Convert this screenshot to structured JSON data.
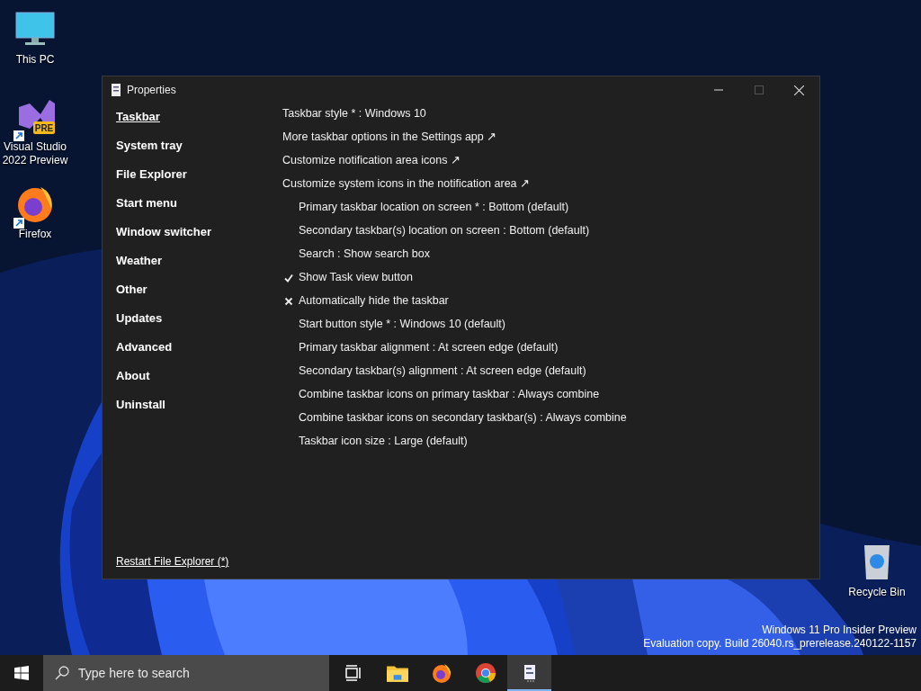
{
  "desktop_icons": [
    {
      "label": "This PC",
      "kind": "monitor",
      "shortcut": false
    },
    {
      "label": "Visual Studio\n2022 Preview",
      "kind": "vs",
      "shortcut": true,
      "badge": "PRE"
    },
    {
      "label": "Firefox",
      "kind": "firefox",
      "shortcut": true
    }
  ],
  "recycle_bin": {
    "label": "Recycle Bin"
  },
  "window": {
    "title": "Properties"
  },
  "sidebar": {
    "items": [
      {
        "label": "Taskbar",
        "selected": true
      },
      {
        "label": "System tray",
        "selected": false
      },
      {
        "label": "File Explorer",
        "selected": false
      },
      {
        "label": "Start menu",
        "selected": false
      },
      {
        "label": "Window switcher",
        "selected": false
      },
      {
        "label": "Weather",
        "selected": false
      },
      {
        "label": "Other",
        "selected": false
      },
      {
        "label": "Updates",
        "selected": false
      },
      {
        "label": "Advanced",
        "selected": false
      },
      {
        "label": "About",
        "selected": false
      },
      {
        "label": "Uninstall",
        "selected": false
      }
    ],
    "footer_link": "Restart File Explorer (*)"
  },
  "settings": [
    {
      "kind": "option",
      "label": "Taskbar style * : Windows 10"
    },
    {
      "kind": "link",
      "label": "More taskbar options in the Settings app ↗"
    },
    {
      "kind": "link",
      "label": "Customize notification area icons ↗"
    },
    {
      "kind": "link",
      "label": "Customize system icons in the notification area ↗"
    },
    {
      "kind": "sub_option",
      "label": "Primary taskbar location on screen * : Bottom (default)"
    },
    {
      "kind": "sub_option",
      "label": "Secondary taskbar(s) location on screen : Bottom (default)"
    },
    {
      "kind": "sub_option",
      "label": "Search : Show search box"
    },
    {
      "kind": "toggle",
      "label": "Show Task view button",
      "checked": true
    },
    {
      "kind": "toggle",
      "label": "Automatically hide the taskbar",
      "checked": false
    },
    {
      "kind": "sub_option",
      "label": "Start button style * : Windows 10 (default)"
    },
    {
      "kind": "sub_option",
      "label": "Primary taskbar alignment : At screen edge (default)"
    },
    {
      "kind": "sub_option",
      "label": "Secondary taskbar(s) alignment : At screen edge (default)"
    },
    {
      "kind": "sub_option",
      "label": "Combine taskbar icons on primary taskbar : Always combine"
    },
    {
      "kind": "sub_option",
      "label": "Combine taskbar icons on secondary taskbar(s) : Always combine"
    },
    {
      "kind": "sub_option",
      "label": "Taskbar icon size : Large (default)"
    }
  ],
  "watermark_text": [
    "Windows 11 Pro Insider Preview",
    "Evaluation copy. Build 26040.rs_prerelease.240122-1157"
  ],
  "taskbar": {
    "search": {
      "placeholder": "Type here to search"
    },
    "apps": [
      {
        "kind": "taskview",
        "selected": false
      },
      {
        "kind": "folder",
        "selected": false
      },
      {
        "kind": "firefox",
        "selected": false
      },
      {
        "kind": "chrome",
        "selected": false
      },
      {
        "kind": "properties",
        "selected": true
      }
    ]
  }
}
